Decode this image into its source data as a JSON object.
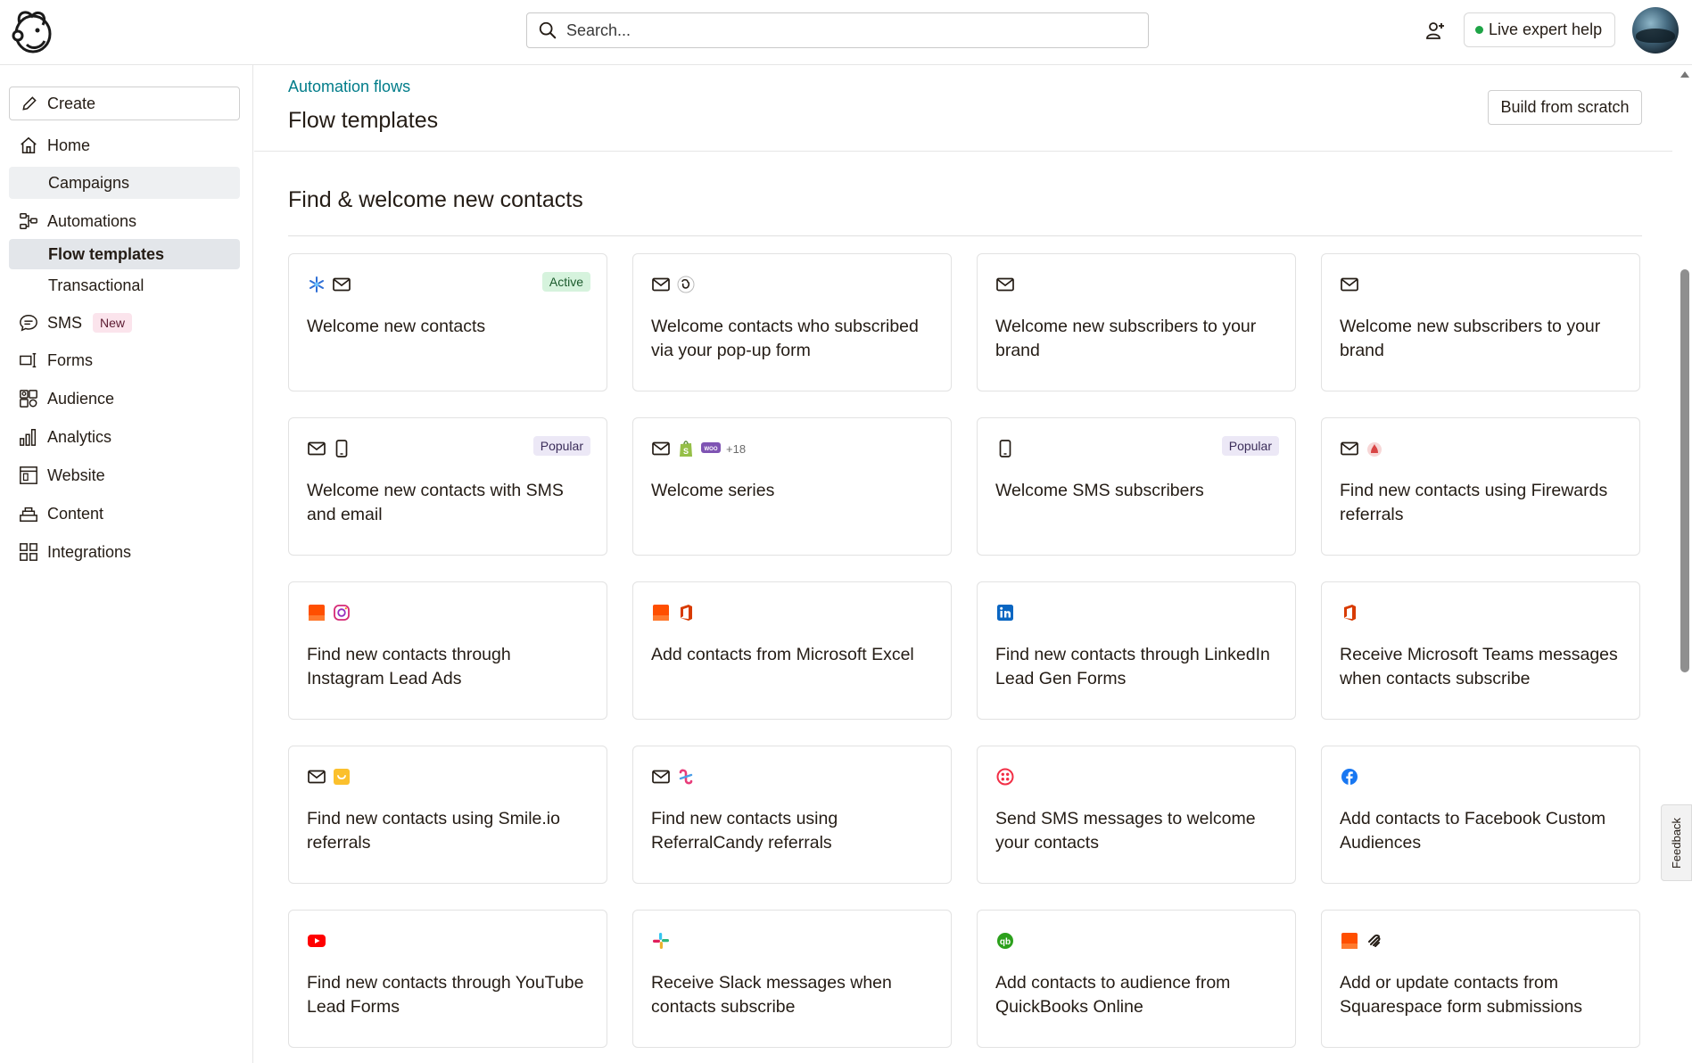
{
  "topbar": {
    "search_placeholder": "Search...",
    "live_help_label": "Live expert help"
  },
  "sidebar": {
    "create_label": "Create",
    "items": [
      {
        "label": "Home"
      },
      {
        "label": "Campaigns"
      },
      {
        "label": "Automations"
      },
      {
        "label": "Flow templates"
      },
      {
        "label": "Transactional"
      },
      {
        "label": "SMS",
        "badge": "New"
      },
      {
        "label": "Forms"
      },
      {
        "label": "Audience"
      },
      {
        "label": "Analytics"
      },
      {
        "label": "Website"
      },
      {
        "label": "Content"
      },
      {
        "label": "Integrations"
      }
    ]
  },
  "main": {
    "breadcrumb": "Automation flows",
    "page_title": "Flow templates",
    "build_button": "Build from scratch",
    "section_title": "Find & welcome new contacts",
    "cards": [
      {
        "title": "Welcome new contacts",
        "badge": "Active",
        "icons": [
          "snowflake-icon",
          "email-icon"
        ]
      },
      {
        "title": "Welcome contacts who subscribed via your pop-up form",
        "icons": [
          "email-icon",
          "mailchimp-icon"
        ]
      },
      {
        "title": "Welcome new subscribers to your brand",
        "icons": [
          "email-icon"
        ]
      },
      {
        "title": "Welcome new subscribers to your brand",
        "icons": [
          "email-icon"
        ]
      },
      {
        "title": "Welcome new contacts with SMS and email",
        "badge": "Popular",
        "icons": [
          "email-icon",
          "phone-icon"
        ]
      },
      {
        "title": "Welcome series",
        "icons": [
          "email-icon",
          "shopify-icon",
          "woo-icon"
        ],
        "more": "+18"
      },
      {
        "title": "Welcome SMS subscribers",
        "badge": "Popular",
        "icons": [
          "phone-icon"
        ]
      },
      {
        "title": "Find new contacts using Firewards referrals",
        "icons": [
          "email-icon",
          "firewards-icon"
        ]
      },
      {
        "title": "Find new contacts through Instagram Lead Ads",
        "icons": [
          "zapier-icon",
          "instagram-icon"
        ]
      },
      {
        "title": "Add contacts from Microsoft Excel",
        "icons": [
          "zapier-icon",
          "office-icon"
        ]
      },
      {
        "title": "Find new contacts through LinkedIn Lead Gen Forms",
        "icons": [
          "linkedin-icon"
        ]
      },
      {
        "title": "Receive Microsoft Teams messages when contacts subscribe",
        "icons": [
          "office-icon"
        ]
      },
      {
        "title": "Find new contacts using Smile.io referrals",
        "icons": [
          "email-icon",
          "smile-icon"
        ]
      },
      {
        "title": "Find new contacts using ReferralCandy referrals",
        "icons": [
          "email-icon",
          "referralcandy-icon"
        ]
      },
      {
        "title": "Send SMS messages to welcome your contacts",
        "icons": [
          "twilio-icon"
        ]
      },
      {
        "title": "Add contacts to Facebook Custom Audiences",
        "icons": [
          "facebook-icon"
        ]
      },
      {
        "title": "Find new contacts through YouTube Lead Forms",
        "icons": [
          "youtube-icon"
        ]
      },
      {
        "title": "Receive Slack messages when contacts subscribe",
        "icons": [
          "slack-icon"
        ]
      },
      {
        "title": "Add contacts to audience from QuickBooks Online",
        "icons": [
          "quickbooks-icon"
        ]
      },
      {
        "title": "Add or update contacts from Squarespace form submissions",
        "icons": [
          "zapier-icon",
          "squarespace-icon"
        ]
      }
    ]
  },
  "feedback_label": "Feedback"
}
